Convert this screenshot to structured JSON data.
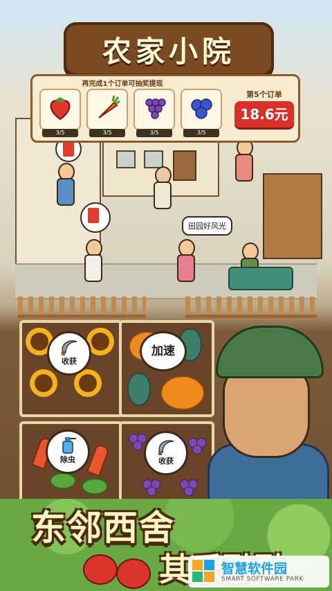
{
  "game": {
    "title": "农家小院",
    "order_hint": "再完成1个订单可抽奖提现",
    "order_label": "第5个订单",
    "order_value": "18.6元",
    "crops": [
      {
        "name": "strawberry-icon",
        "progress": "3/5"
      },
      {
        "name": "carrot-icon",
        "progress": "3/5"
      },
      {
        "name": "grape-icon",
        "progress": "3/5"
      },
      {
        "name": "blueberry-icon",
        "progress": "3/5"
      }
    ],
    "speech": "田园好风光",
    "plots": {
      "sunflower_action": "收获",
      "pumpkin_action": "加速",
      "carrot_action": "除虫",
      "grape_action": "收获"
    },
    "slogan_line1": "东邻西舍",
    "slogan_line2": "其乐融融"
  },
  "watermark": {
    "name": "智慧软件园",
    "sub": "SMART SOFTWARE PARK"
  },
  "colors": {
    "order_red": "#d8312a",
    "wood": "#7a4a22",
    "panel": "#f7ecd0"
  }
}
